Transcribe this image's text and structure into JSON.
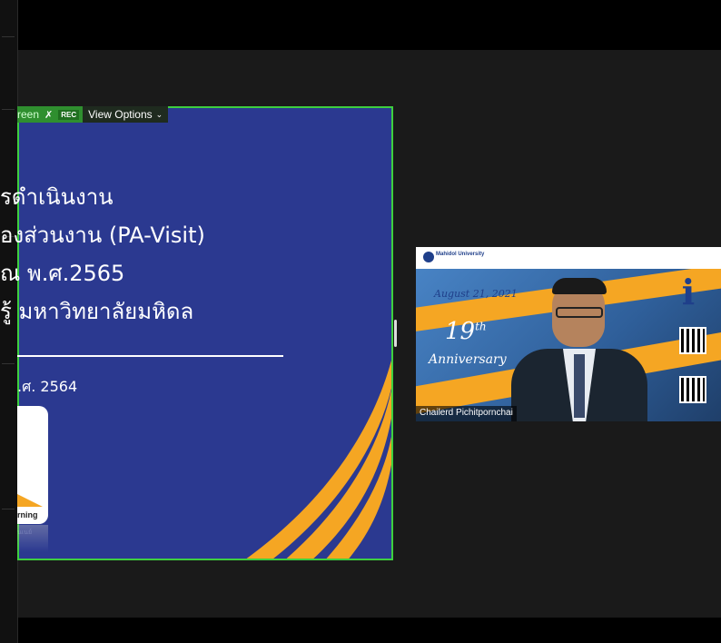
{
  "share_toolbar": {
    "sharing_label": "reen",
    "rec_badge": "REC",
    "view_options_label": "View Options",
    "chevron": "chevron-down-icon"
  },
  "slide": {
    "title_lines": [
      "รดำเนินงาน",
      "องส่วนงาน (PA-Visit)",
      "ณ พ.ศ.2565",
      "รู้ มหาวิทยาลัยมหิดล"
    ],
    "date_line": ".ศ. 2564",
    "logo_label": "rning",
    "logo_sublabel": "นเนย์"
  },
  "participant": {
    "name": "Chailerd Pichitpornchai",
    "background": {
      "org_name": "Mahidol University",
      "date": "August 21, 2021",
      "anniversary_number": "19",
      "anniversary_suffix": "th",
      "anniversary_word": "Anniversary"
    }
  },
  "colors": {
    "slide_bg": "#2b3990",
    "share_border": "#3ecf3e",
    "accent_gold": "#f5a623"
  }
}
